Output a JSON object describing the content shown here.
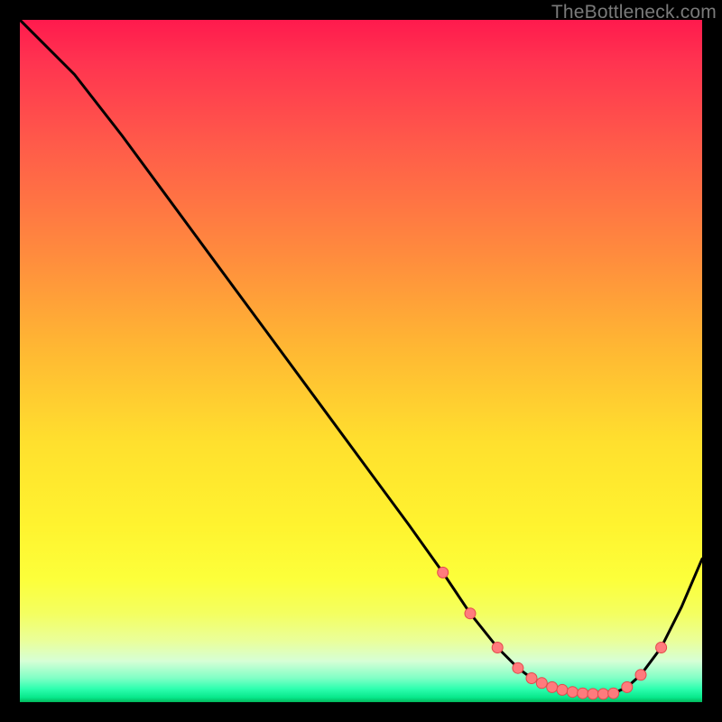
{
  "watermark": "TheBottleneck.com",
  "colors": {
    "curve": "#000000",
    "marker_fill": "#ff7b7d",
    "marker_stroke": "#e24a4c"
  },
  "chart_data": {
    "type": "line",
    "title": "",
    "xlabel": "",
    "ylabel": "",
    "xlim": [
      0,
      100
    ],
    "ylim": [
      0,
      100
    ],
    "grid": false,
    "series": [
      {
        "name": "bottleneck-curve",
        "x": [
          0,
          8,
          15,
          22,
          29,
          36,
          43,
          50,
          57,
          62,
          66,
          70,
          73,
          75,
          78,
          81,
          84,
          87,
          89,
          91,
          94,
          97,
          100
        ],
        "values": [
          100,
          92,
          83,
          73.5,
          64,
          54.5,
          45,
          35.5,
          26,
          19,
          13,
          8,
          5,
          3.5,
          2.2,
          1.5,
          1.2,
          1.3,
          2.2,
          4,
          8,
          14,
          21
        ]
      }
    ],
    "markers": {
      "name": "bottleneck-markers",
      "x": [
        62,
        66,
        70,
        73,
        75,
        76.5,
        78,
        79.5,
        81,
        82.5,
        84,
        85.5,
        87,
        89,
        91,
        94
      ],
      "values": [
        19,
        13,
        8,
        5,
        3.5,
        2.8,
        2.2,
        1.8,
        1.5,
        1.3,
        1.2,
        1.2,
        1.3,
        2.2,
        4,
        8
      ]
    }
  }
}
